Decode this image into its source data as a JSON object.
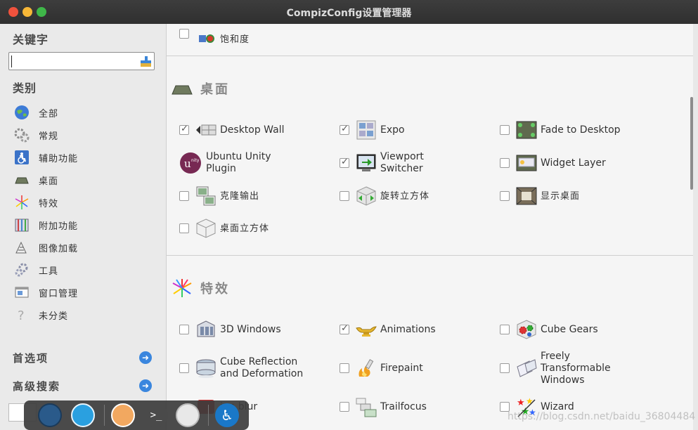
{
  "window": {
    "title": "CompizConfig设置管理器"
  },
  "sidebar": {
    "keyword_heading": "关键字",
    "search_value": "",
    "category_heading": "类别",
    "categories": [
      {
        "label": "全部",
        "icon": "globe-icon"
      },
      {
        "label": "常规",
        "icon": "gears-icon"
      },
      {
        "label": "辅助功能",
        "icon": "accessibility-icon"
      },
      {
        "label": "桌面",
        "icon": "desktop-icon"
      },
      {
        "label": "特效",
        "icon": "fireworks-icon"
      },
      {
        "label": "附加功能",
        "icon": "extras-icon"
      },
      {
        "label": "图像加载",
        "icon": "image-loading-icon"
      },
      {
        "label": "工具",
        "icon": "tools-icon"
      },
      {
        "label": "窗口管理",
        "icon": "window-management-icon"
      },
      {
        "label": "未分类",
        "icon": "uncategorized-icon"
      }
    ],
    "preferences_label": "首选项",
    "advanced_search_label": "高级搜索"
  },
  "main": {
    "top_partial_plugin": {
      "label": "饱和度",
      "checked": false
    },
    "sections": [
      {
        "title": "桌面",
        "plugins": [
          {
            "label": "Desktop Wall",
            "checked": true
          },
          {
            "label": "Expo",
            "checked": true
          },
          {
            "label": "Fade to Desktop",
            "checked": false
          },
          {
            "label": "Ubuntu Unity\nPlugin",
            "checked": null
          },
          {
            "label": "Viewport\nSwitcher",
            "checked": true
          },
          {
            "label": "Widget Layer",
            "checked": false
          },
          {
            "label": "克隆输出",
            "checked": false
          },
          {
            "label": "旋转立方体",
            "checked": false
          },
          {
            "label": "显示桌面",
            "checked": false
          },
          {
            "label": "桌面立方体",
            "checked": false
          }
        ]
      },
      {
        "title": "特效",
        "plugins": [
          {
            "label": "3D Windows",
            "checked": false
          },
          {
            "label": "Animations",
            "checked": true
          },
          {
            "label": "Cube Gears",
            "checked": false
          },
          {
            "label": "Cube Reflection\nand Deformation",
            "checked": false
          },
          {
            "label": "Firepaint",
            "checked": false
          },
          {
            "label": "Freely\nTransformable\nWindows",
            "checked": false
          },
          {
            "label": "ion blur",
            "checked": null
          },
          {
            "label": "Trailfocus",
            "checked": false
          },
          {
            "label": "Wizard",
            "checked": false
          }
        ]
      }
    ]
  },
  "dock": {
    "icons": [
      "screenshot-app-icon",
      "text-editor-icon",
      "software-center-icon",
      "terminal-icon",
      "magic-wand-icon",
      "accessibility-icon"
    ]
  },
  "watermark": "https://blog.csdn.net/baidu_36804484"
}
